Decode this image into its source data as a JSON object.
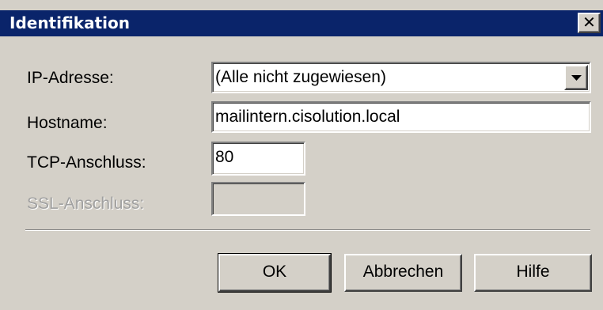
{
  "window": {
    "title": "Identifikation",
    "close_glyph": "✕"
  },
  "form": {
    "ip_label": "IP-Adresse:",
    "ip_value": "(Alle nicht zugewiesen)",
    "hostname_label": "Hostname:",
    "hostname_value": "mailintern.cisolution.local",
    "tcp_label": "TCP-Anschluss:",
    "tcp_value": "80",
    "ssl_label": "SSL-Anschluss:",
    "ssl_value": ""
  },
  "buttons": {
    "ok": "OK",
    "cancel": "Abbrechen",
    "help": "Hilfe"
  },
  "colors": {
    "title_bar": "#0a246a",
    "dialog_bg": "#d4d0c8",
    "disabled_text": "#a0a0a0"
  },
  "icons": {
    "dropdown": "chevron-down-icon",
    "close": "close-icon"
  }
}
